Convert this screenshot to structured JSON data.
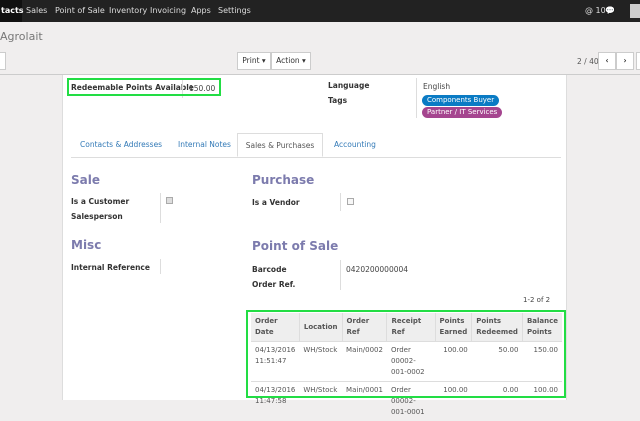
{
  "nav": {
    "items": [
      "tacts",
      "Sales",
      "Point of Sale",
      "Inventory",
      "Invoicing",
      "Apps",
      "Settings"
    ],
    "messages_count": "10"
  },
  "breadcrumb": "Agrolait",
  "toolbar": {
    "print": "Print",
    "action": "Action",
    "pager": "2 / 40"
  },
  "form": {
    "redeemable_label": "Redeemable Points Available",
    "redeemable_value": "150.00",
    "language_label": "Language",
    "language_value": "English",
    "tags_label": "Tags",
    "tags": [
      {
        "label": "Components Buyer",
        "color": "#0a7bc4"
      },
      {
        "label": "Partner / IT Services",
        "color": "#a5458f"
      }
    ],
    "tabs": [
      "Contacts & Addresses",
      "Internal Notes",
      "Sales & Purchases",
      "Accounting"
    ],
    "active_tab": "Sales & Purchases",
    "sale": {
      "title": "Sale",
      "is_customer": "Is a Customer",
      "is_customer_checked": true,
      "salesperson": "Salesperson"
    },
    "purchase": {
      "title": "Purchase",
      "is_vendor": "Is a Vendor",
      "is_vendor_checked": false
    },
    "misc": {
      "title": "Misc",
      "internal_ref": "Internal Reference"
    },
    "pos": {
      "title": "Point of Sale",
      "barcode_label": "Barcode",
      "barcode_value": "0420200000004",
      "order_ref_label": "Order Ref."
    },
    "table": {
      "pager": "1-2 of 2",
      "headers": [
        "Order Date",
        "Location",
        "Order Ref",
        "Receipt Ref",
        "Points Earned",
        "Points Redeemed",
        "Balance Points"
      ],
      "rows": [
        [
          "04/13/2016 11:51:47",
          "WH/Stock",
          "Main/0002",
          "Order 00002-001-0002",
          "100.00",
          "50.00",
          "150.00"
        ],
        [
          "04/13/2016 11:47:58",
          "WH/Stock",
          "Main/0001",
          "Order 00002-001-0001",
          "100.00",
          "0.00",
          "100.00"
        ]
      ]
    }
  }
}
